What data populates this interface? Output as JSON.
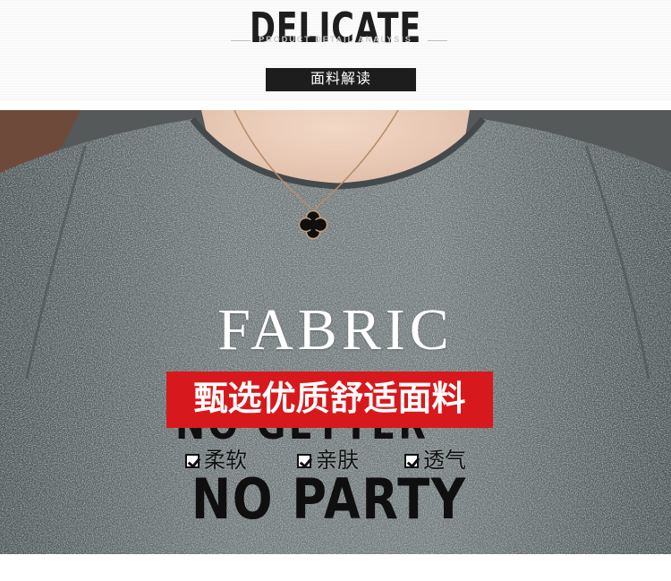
{
  "header": {
    "title": "DELICATE",
    "subtitle": "PRODUCT DETAIL ANALYSIS",
    "tag": "面料解读"
  },
  "photo": {
    "headline": "FABRIC",
    "banner": "甄选优质舒适面料",
    "shirt_print_top": "NO GETTER",
    "shirt_print_main": "NO PARTY",
    "features": [
      {
        "label": "柔软",
        "icon": "checkbox-icon"
      },
      {
        "label": "亲肤",
        "icon": "checkbox-icon"
      },
      {
        "label": "透气",
        "icon": "checkbox-icon"
      }
    ]
  },
  "colors": {
    "banner_red": "#d7191d",
    "tag_black": "#1d1d1d",
    "shirt_gray": "#6b7374"
  }
}
